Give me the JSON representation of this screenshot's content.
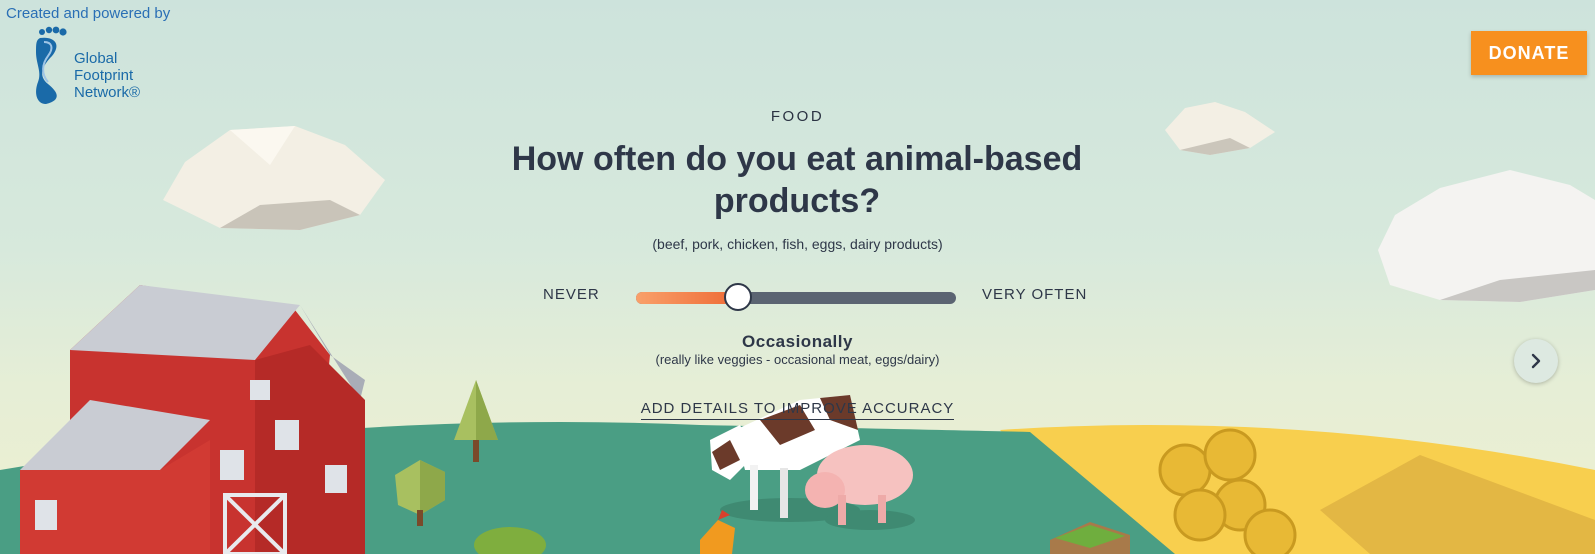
{
  "credit": {
    "text": "Created and powered by"
  },
  "logo": {
    "line1": "Global",
    "line2": "Footprint",
    "line3": "Network®"
  },
  "donate": {
    "label": "DONATE"
  },
  "question": {
    "category": "FOOD",
    "title": "How often do you eat animal-based products?",
    "subtitle": "(beef, pork, chicken, fish, eggs, dairy products)"
  },
  "slider": {
    "min_label": "NEVER",
    "max_label": "VERY OFTEN",
    "value": 0.32,
    "selected_label": "Occasionally",
    "selected_description": "(really like veggies - occasional meat, eggs/dairy)"
  },
  "details_link": {
    "label": "ADD DETAILS TO IMPROVE ACCURACY"
  },
  "icons": [
    "footprint-logo-icon",
    "chevron-right-icon"
  ],
  "colors": {
    "accent": "#f7901e",
    "text": "#2e3748",
    "ground": "#4a9e84",
    "field": "#f8cf4e"
  }
}
